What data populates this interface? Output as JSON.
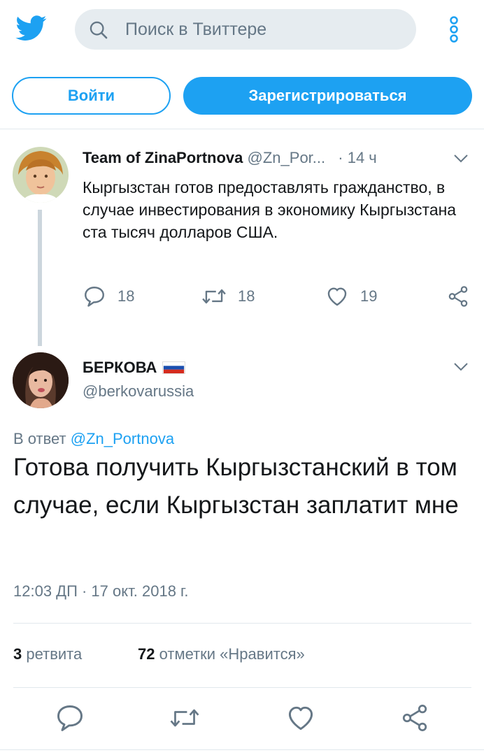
{
  "header": {
    "search_placeholder": "Поиск в Твиттере",
    "login_label": "Войти",
    "signup_label": "Зарегистрироваться"
  },
  "tweet1": {
    "author_name": "Team of ZinaPortnova",
    "author_handle": "@Zn_Por...",
    "separator": "·",
    "time": "14 ч",
    "text": "Кыргызстан готов предоставлять гражданство, в случае инвестирования в экономику Кыргызстана ста тысяч долларов США.",
    "replies": "18",
    "retweets": "18",
    "likes": "19"
  },
  "tweet2": {
    "author_name": "БЕРКОВА",
    "author_handle": "@berkovarussia",
    "reply_prefix": "В ответ",
    "reply_to": "@Zn_Portnova",
    "text": "Готова получить Кыргызстанский в том случае, если Кыргызстан заплатит мне",
    "timestamp": "12:03 ДП · 17 окт. 2018 г.",
    "retweet_count": "3",
    "retweet_label": "ретвита",
    "like_count": "72",
    "like_label": "отметки «Нравится»"
  },
  "icons": {
    "logo": "twitter-bird-icon",
    "search": "search-icon",
    "menu": "more-vertical-icon",
    "reply": "reply-icon",
    "retweet": "retweet-icon",
    "like": "heart-icon",
    "share": "share-icon",
    "chevron": "chevron-down-icon",
    "flag": "russian-flag-icon"
  },
  "colors": {
    "brand": "#1da1f2",
    "muted": "#657786",
    "text": "#14171a",
    "divider": "#e1e8ed"
  }
}
